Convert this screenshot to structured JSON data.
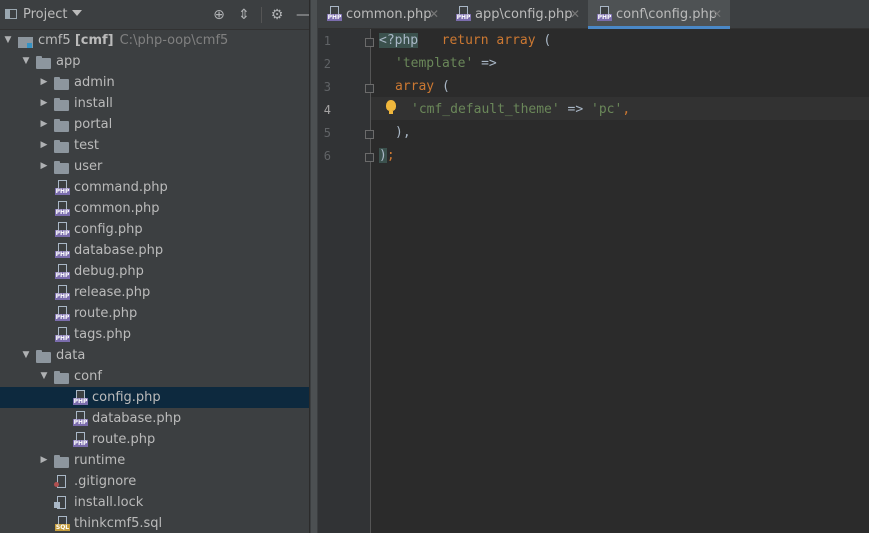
{
  "project_panel": {
    "title": "Project",
    "toolbar_icons": [
      "locate-icon",
      "collapse-icon",
      "gear-icon",
      "hide-icon"
    ]
  },
  "tree": [
    {
      "label": "cmf5",
      "module": "[cmf]",
      "path": "C:\\php-oop\\cmf5",
      "type": "module",
      "depth": 0,
      "expanded": true
    },
    {
      "label": "app",
      "type": "folder",
      "depth": 1,
      "expanded": true
    },
    {
      "label": "admin",
      "type": "folder",
      "depth": 2,
      "expanded": false
    },
    {
      "label": "install",
      "type": "folder",
      "depth": 2,
      "expanded": false
    },
    {
      "label": "portal",
      "type": "folder",
      "depth": 2,
      "expanded": false
    },
    {
      "label": "test",
      "type": "folder",
      "depth": 2,
      "expanded": false
    },
    {
      "label": "user",
      "type": "folder",
      "depth": 2,
      "expanded": false
    },
    {
      "label": "command.php",
      "type": "php",
      "depth": 2
    },
    {
      "label": "common.php",
      "type": "php",
      "depth": 2
    },
    {
      "label": "config.php",
      "type": "php",
      "depth": 2
    },
    {
      "label": "database.php",
      "type": "php",
      "depth": 2
    },
    {
      "label": "debug.php",
      "type": "php",
      "depth": 2
    },
    {
      "label": "release.php",
      "type": "php",
      "depth": 2
    },
    {
      "label": "route.php",
      "type": "php",
      "depth": 2
    },
    {
      "label": "tags.php",
      "type": "php",
      "depth": 2
    },
    {
      "label": "data",
      "type": "folder",
      "depth": 1,
      "expanded": true
    },
    {
      "label": "conf",
      "type": "folder",
      "depth": 2,
      "expanded": true
    },
    {
      "label": "config.php",
      "type": "php",
      "depth": 3,
      "selected": true
    },
    {
      "label": "database.php",
      "type": "php",
      "depth": 3
    },
    {
      "label": "route.php",
      "type": "php",
      "depth": 3
    },
    {
      "label": "runtime",
      "type": "folder",
      "depth": 2,
      "expanded": false
    },
    {
      "label": ".gitignore",
      "type": "git",
      "depth": 2
    },
    {
      "label": "install.lock",
      "type": "lock",
      "depth": 2
    },
    {
      "label": "thinkcmf5.sql",
      "type": "sql",
      "depth": 2
    }
  ],
  "tabs": [
    {
      "label": "common.php",
      "active": false
    },
    {
      "label": "app\\config.php",
      "active": false
    },
    {
      "label": "conf\\config.php",
      "active": true
    }
  ],
  "editor": {
    "current_line": 4,
    "lines": [
      {
        "num": "1"
      },
      {
        "num": "2"
      },
      {
        "num": "3"
      },
      {
        "num": "4"
      },
      {
        "num": "5"
      },
      {
        "num": "6"
      }
    ],
    "code": {
      "l1_open": "<?php",
      "l1_return": "return",
      "l1_array": "array",
      "l1_paren": " (",
      "l2_str": "'template'",
      "l2_arrow": " =>",
      "l3_array": "array",
      "l3_paren": " (",
      "l4_key": "'cmf_default_theme'",
      "l4_arrow": " => ",
      "l4_val": "'pc'",
      "l4_comma": ",",
      "l5_close": "),",
      "l6_close": ")",
      "l6_semi": ";"
    }
  },
  "colors": {
    "panel_bg": "#3c3f41",
    "editor_bg": "#2b2b2b",
    "keyword": "#cc7832",
    "string": "#6a8759",
    "selection": "#0d293e",
    "tab_underline": "#4a88c7"
  }
}
